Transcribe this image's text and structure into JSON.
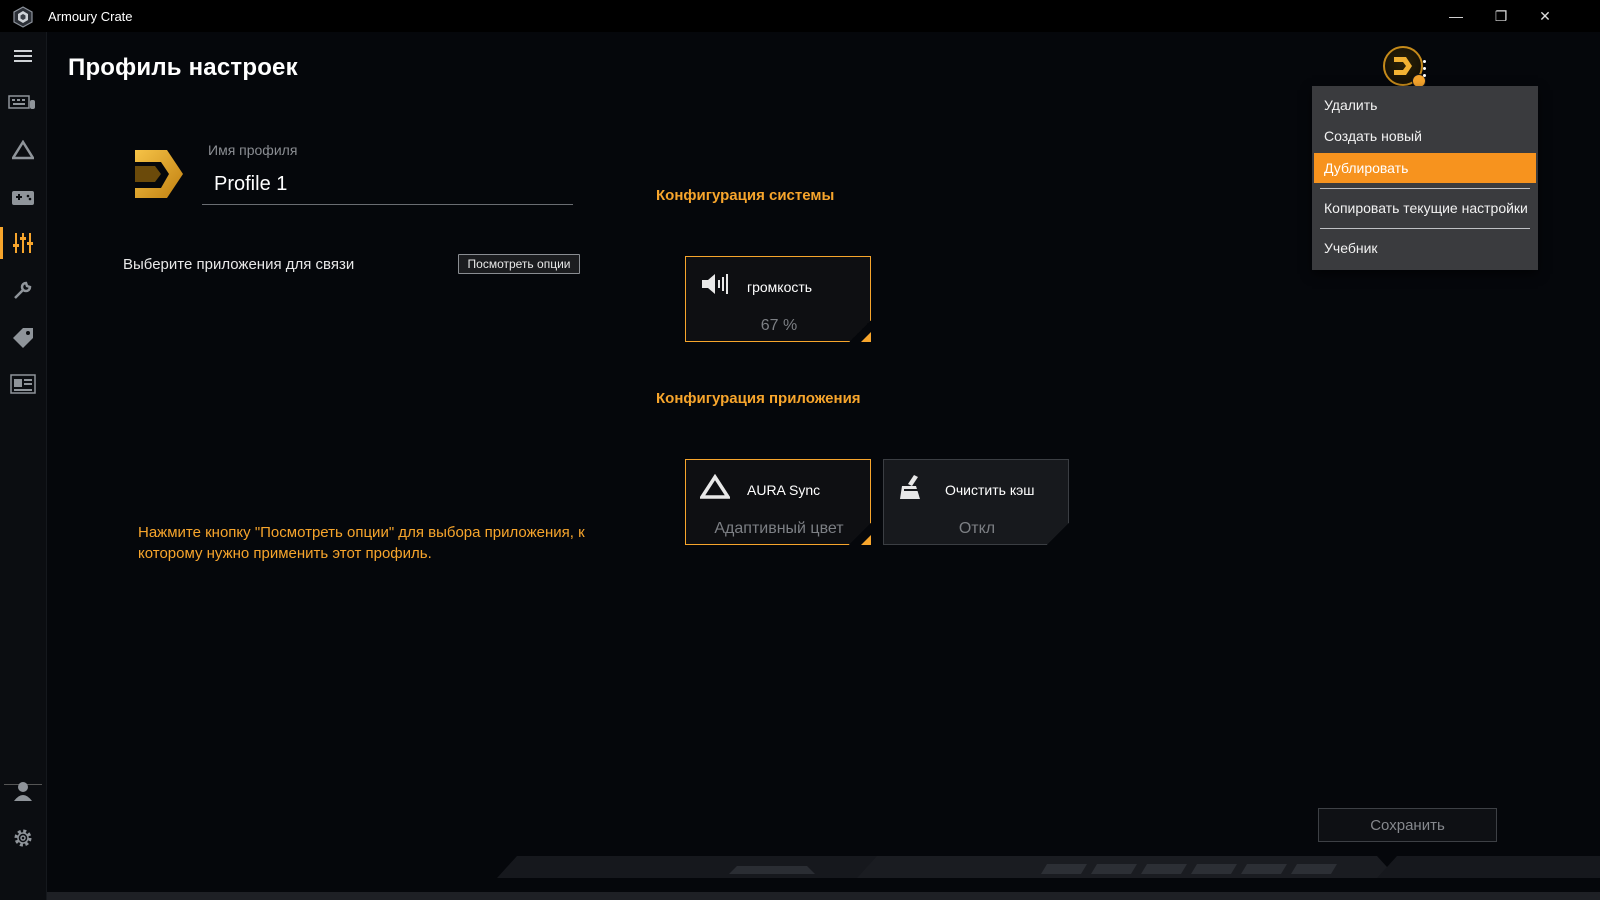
{
  "window": {
    "title": "Armoury Crate",
    "minimize_glyph": "—",
    "restore_glyph": "❐",
    "close_glyph": "✕"
  },
  "sidebar": {
    "items": [
      {
        "icon": "hamburger-menu-icon"
      },
      {
        "icon": "devices-icon"
      },
      {
        "icon": "aura-icon"
      },
      {
        "icon": "game-library-icon"
      },
      {
        "icon": "scenario-profiles-icon",
        "active": true
      },
      {
        "icon": "tools-icon"
      },
      {
        "icon": "deals-tag-icon"
      },
      {
        "icon": "news-icon"
      },
      {
        "icon": "user-icon"
      },
      {
        "icon": "settings-gear-icon"
      }
    ]
  },
  "page": {
    "title": "Профиль настроек"
  },
  "profile": {
    "name_label": "Имя профиля",
    "name_value": "Profile 1",
    "link_apps_label": "Выберите приложения для связи",
    "view_options_button": "Посмотреть опции",
    "hint": "Нажмите кнопку \"Посмотреть опции\" для выбора приложения, к которому нужно применить этот профиль."
  },
  "system_config": {
    "title": "Конфигурация системы",
    "tiles": [
      {
        "label": "громкость",
        "value": "67 %",
        "icon": "speaker-volume-icon",
        "active": true
      }
    ]
  },
  "app_config": {
    "title": "Конфигурация приложения",
    "tiles": [
      {
        "label": "AURA Sync",
        "value": "Адаптивный цвет",
        "icon": "aura-sync-icon",
        "active": true
      },
      {
        "label": "Очистить кэш",
        "value": "Откл",
        "icon": "clear-cache-broom-icon",
        "active": false
      }
    ]
  },
  "menu": {
    "items": [
      {
        "label": "Удалить"
      },
      {
        "label": "Создать новый"
      },
      {
        "label": "Дублировать",
        "highlighted": true
      },
      {
        "label": "Копировать текущие настройки"
      },
      {
        "label": "Учебник"
      }
    ]
  },
  "save_button": "Сохранить",
  "colors": {
    "accent": "#f7a52c",
    "menu_highlight": "#f7931e",
    "background": "#05070b"
  }
}
